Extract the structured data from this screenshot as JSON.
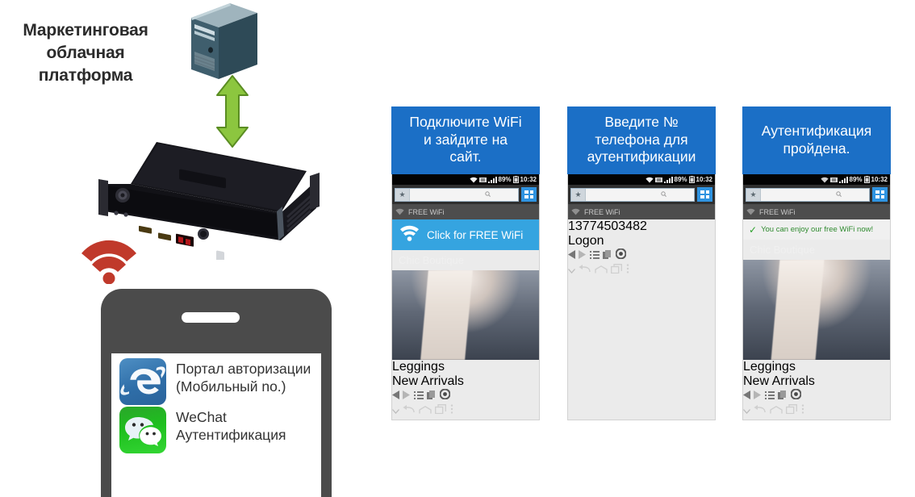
{
  "diagram": {
    "cloud_label_lines": [
      "Маркетинговая",
      "облачная",
      "платформа"
    ],
    "server_icon": "server-tower-icon",
    "arrow_icon": "bidirectional-sync-arrow-icon",
    "gateway_icon": "wifi-gateway-appliance",
    "wifi_icon": "wifi-broadcast-icon",
    "accent_green": "#8CC63F",
    "accent_red": "#C0392B",
    "accent_blue": "#1B6FC6"
  },
  "handset": {
    "apps": [
      {
        "icon": "internet-explorer-icon",
        "label": "Портал авторизации (Мобильный no.)"
      },
      {
        "icon": "wechat-icon",
        "label": "WeChat Аутентификация"
      }
    ]
  },
  "status_bar": {
    "battery": "89%",
    "time": "10:32",
    "wifi_icon": "wifi-icon",
    "signal_icon": "signal-bars-icon",
    "battery_icon": "battery-icon"
  },
  "browser_bar": {
    "star_icon": "star-icon",
    "url_value": "",
    "url_placeholder": "",
    "search_icon": "search-icon",
    "apps_icon": "apps-grid-icon"
  },
  "ssid_row": {
    "icon": "wifi-icon",
    "label": "FREE WiFi"
  },
  "toolbar": {
    "back_icon": "back-triangle-icon",
    "forward_icon": "forward-triangle-icon",
    "menu_icon": "list-menu-icon",
    "tabs_icon": "tabs-icon",
    "home_icon": "browser-home-icon"
  },
  "android_nav": {
    "hide_icon": "chevron-down-icon",
    "back_icon": "android-back-icon",
    "home_icon": "android-home-icon",
    "recents_icon": "android-recents-icon",
    "more_icon": "overflow-menu-icon"
  },
  "panels": [
    {
      "id": "panel-1",
      "banner_lines": [
        "Подключите WiFi",
        "и зайдите на",
        "сайт."
      ],
      "cta": {
        "icon": "wifi-icon",
        "label": "Click for FREE WiFi"
      },
      "boutique_title": "Chic Boutique",
      "thumbs": [
        {
          "label": "Leggings"
        },
        {
          "label": "New Arrivals"
        }
      ]
    },
    {
      "id": "panel-2",
      "banner_lines": [
        "Введите №",
        "телефона для",
        "аутентификации"
      ],
      "form": {
        "phone_value": "13774503482",
        "phone_placeholder": "",
        "logon_label": "Logon"
      }
    },
    {
      "id": "panel-3",
      "banner_lines": [
        "Аутентификация",
        "пройдена."
      ],
      "success": {
        "check": "✓",
        "message": "You can enjoy our free WiFi now!"
      },
      "boutique_title": "Chic Boutique",
      "thumbs": [
        {
          "label": "Leggings"
        },
        {
          "label": "New Arrivals"
        }
      ]
    }
  ]
}
